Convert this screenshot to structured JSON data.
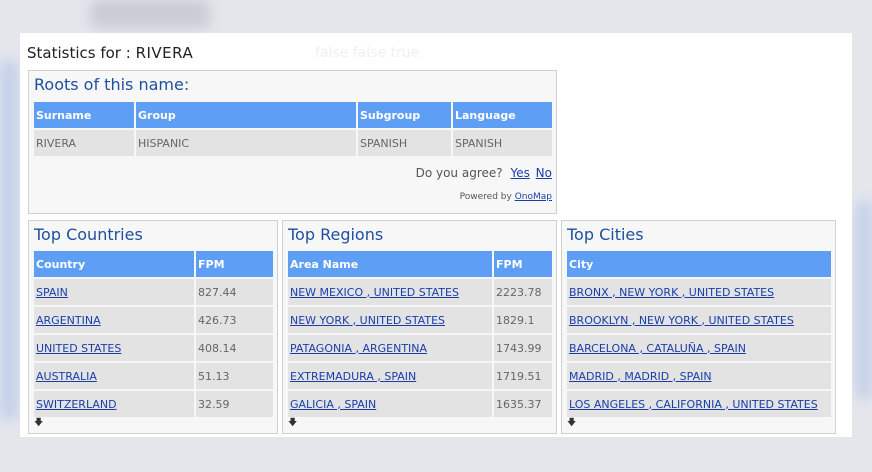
{
  "header": {
    "label": "Statistics for :",
    "surname": "RIVERA",
    "hidden_text": "false false  true"
  },
  "roots": {
    "title": "Roots of this name:",
    "columns": [
      "Surname",
      "Group",
      "Subgroup",
      "Language"
    ],
    "row": [
      "RIVERA",
      "HISPANIC",
      "SPANISH",
      "SPANISH"
    ],
    "agree_prompt": "Do you agree?",
    "yes_label": "Yes",
    "no_label": "No",
    "powered_by": "Powered by",
    "powered_link": "OnoMap"
  },
  "countries": {
    "title": "Top Countries",
    "columns": [
      "Country",
      "FPM"
    ],
    "rows": [
      [
        "SPAIN",
        "827.44"
      ],
      [
        "ARGENTINA",
        "426.73"
      ],
      [
        "UNITED STATES",
        "408.14"
      ],
      [
        "AUSTRALIA",
        "51.13"
      ],
      [
        "SWITZERLAND",
        "32.59"
      ]
    ]
  },
  "regions": {
    "title": "Top Regions",
    "columns": [
      "Area Name",
      "FPM"
    ],
    "rows": [
      [
        "NEW MEXICO , UNITED STATES",
        "2223.78"
      ],
      [
        "NEW YORK , UNITED STATES",
        "1829.1"
      ],
      [
        "PATAGONIA , ARGENTINA",
        "1743.99"
      ],
      [
        "EXTREMADURA , SPAIN",
        "1719.51"
      ],
      [
        "GALICIA , SPAIN",
        "1635.37"
      ]
    ]
  },
  "cities": {
    "title": "Top Cities",
    "columns": [
      "City"
    ],
    "rows": [
      [
        "BRONX , NEW YORK , UNITED STATES"
      ],
      [
        "BROOKLYN , NEW YORK , UNITED STATES"
      ],
      [
        "BARCELONA , CATALUÑA , SPAIN"
      ],
      [
        "MADRID , MADRID , SPAIN"
      ],
      [
        "LOS ANGELES , CALIFORNIA , UNITED STATES"
      ]
    ]
  },
  "icons": {
    "more": "download-arrow-icon"
  },
  "colors": {
    "header_bg": "#5e9ef5",
    "title_blue": "#1f4fa0",
    "link": "#1a3ea8",
    "cell_bg": "#e3e3e3"
  }
}
